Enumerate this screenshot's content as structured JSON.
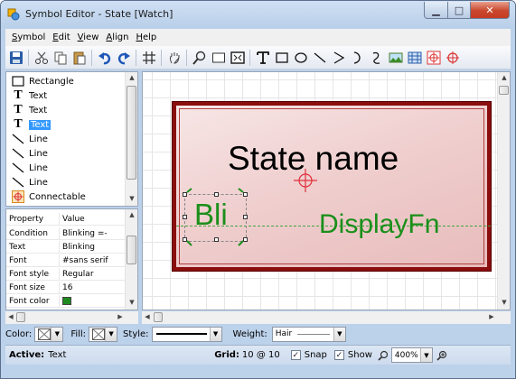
{
  "window": {
    "title": "Symbol Editor - State [Watch]"
  },
  "menu": [
    {
      "label": "Symbol",
      "accel": "S",
      "rest": "ymbol"
    },
    {
      "label": "Edit",
      "accel": "E",
      "rest": "dit"
    },
    {
      "label": "View",
      "accel": "V",
      "rest": "iew"
    },
    {
      "label": "Align",
      "accel": "A",
      "rest": "lign"
    },
    {
      "label": "Help",
      "accel": "H",
      "rest": "elp"
    }
  ],
  "toolbar": {
    "icons": [
      "save-icon",
      "cut-icon",
      "copy-icon",
      "paste-icon",
      "undo-icon",
      "redo-icon",
      "grid-icon",
      "pan-icon",
      "zoom-icon",
      "rectangle-tool-icon",
      "fit-icon",
      "text-tool-icon",
      "box-tool-icon",
      "ellipse-tool-icon",
      "line-tool-icon",
      "polyline-tool-icon",
      "arc-tool-icon",
      "curve-tool-icon",
      "image-tool-icon",
      "bar-tool-icon",
      "connectable-tool-icon",
      "port-tool-icon"
    ]
  },
  "palette": {
    "items": [
      {
        "label": "Rectangle",
        "icon": "rectangle-icon",
        "selected": false
      },
      {
        "label": "Text",
        "icon": "text-icon",
        "selected": false
      },
      {
        "label": "Text",
        "icon": "text-icon",
        "selected": false
      },
      {
        "label": "Text",
        "icon": "text-icon",
        "selected": true
      },
      {
        "label": "Line",
        "icon": "line-icon",
        "selected": false
      },
      {
        "label": "Line",
        "icon": "line-icon",
        "selected": false
      },
      {
        "label": "Line",
        "icon": "line-icon",
        "selected": false
      },
      {
        "label": "Line",
        "icon": "line-icon",
        "selected": false
      },
      {
        "label": "Connectable",
        "icon": "connectable-icon",
        "selected": false
      }
    ]
  },
  "properties": {
    "header": {
      "key": "Property",
      "value": "Value"
    },
    "rows": [
      {
        "key": "Condition",
        "value": "Blinking =-"
      },
      {
        "key": "Text",
        "value": "Blinking"
      },
      {
        "key": "Font",
        "value": "#sans serif"
      },
      {
        "key": "Font style",
        "value": "Regular"
      },
      {
        "key": "Font size",
        "value": "16"
      },
      {
        "key": "Font color",
        "value": ""
      }
    ],
    "font_color": "#1f8a1f"
  },
  "canvas": {
    "state_name": "State name",
    "blink_text": "Bli",
    "display_fn": "DisplayFn",
    "state_border_color": "#8b0e0e",
    "text_color": "#1a8f1a"
  },
  "stylebar": {
    "color_label": "Color:",
    "fill_label": "Fill:",
    "style_label": "Style:",
    "weight_label": "Weight:",
    "weight_value": "Hair"
  },
  "statusbar": {
    "active_label": "Active:",
    "active_value": "Text",
    "grid_label": "Grid:",
    "grid_value": "10 @ 10",
    "snap_label": "Snap",
    "snap_checked": true,
    "show_label": "Show",
    "show_checked": true,
    "zoom_value": "400%"
  }
}
